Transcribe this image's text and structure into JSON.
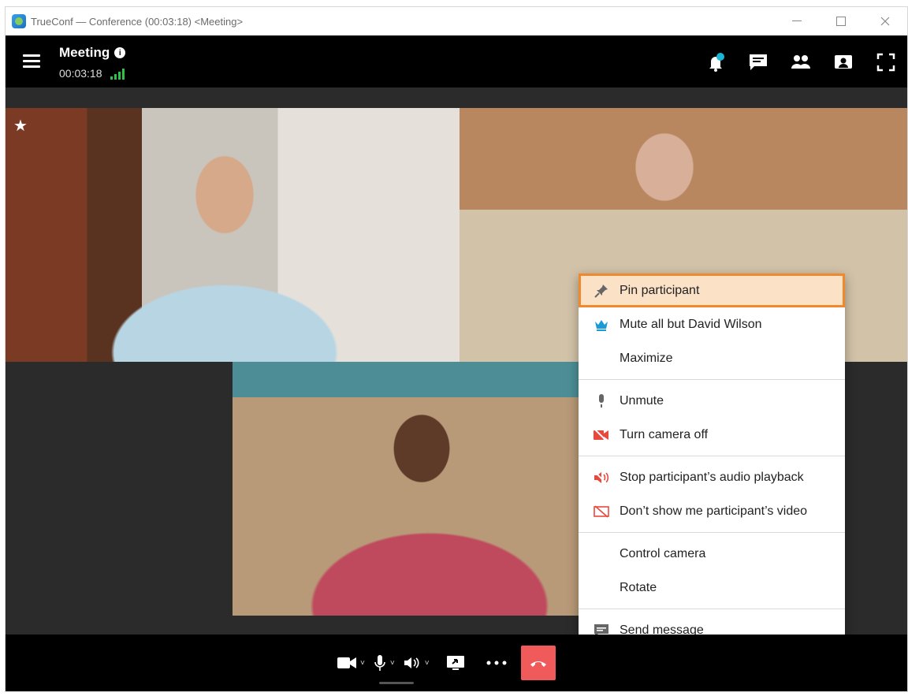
{
  "window": {
    "title": "TrueConf — Conference (00:03:18) <Meeting>"
  },
  "topbar": {
    "meeting_name": "Meeting",
    "elapsed": "00:03:18"
  },
  "menu": {
    "items": [
      {
        "label": "Pin participant",
        "icon": "pin-icon",
        "active": true
      },
      {
        "label": "Mute all but David Wilson",
        "icon": "crown-icon"
      },
      {
        "label": "Maximize",
        "icon": ""
      },
      {
        "label": "Unmute",
        "icon": "microphone-icon"
      },
      {
        "label": "Turn camera off",
        "icon": "camera-off-icon"
      },
      {
        "label": "Stop participant’s audio playback",
        "icon": "speaker-off-icon"
      },
      {
        "label": "Don’t show me participant’s video",
        "icon": "video-hidden-icon"
      },
      {
        "label": "Control camera",
        "icon": ""
      },
      {
        "label": "Rotate",
        "icon": ""
      },
      {
        "label": "Send message",
        "icon": "message-icon"
      }
    ]
  },
  "colors": {
    "accent": "#f0882c",
    "active_bg": "#fbe1c5",
    "hangup": "#f05a5a",
    "signal": "#2fc248",
    "notification_dot": "#19b6d6"
  }
}
